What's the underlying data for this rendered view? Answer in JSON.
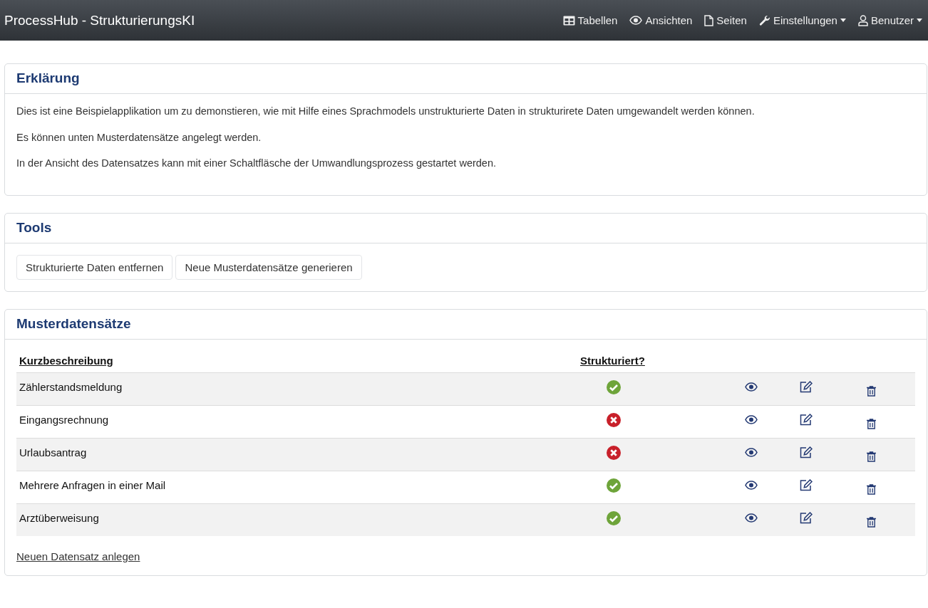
{
  "navbar": {
    "brand": "ProcessHub - StrukturierungsKI",
    "items": [
      {
        "kind": "table",
        "label": "Tabellen",
        "dropdown": false
      },
      {
        "kind": "eye",
        "label": "Ansichten",
        "dropdown": false
      },
      {
        "kind": "page",
        "label": "Seiten",
        "dropdown": false
      },
      {
        "kind": "wrench",
        "label": "Einstellungen",
        "dropdown": true
      },
      {
        "kind": "user",
        "label": "Benutzer",
        "dropdown": true
      }
    ]
  },
  "explanation": {
    "title": "Erklärung",
    "paragraphs": [
      "Dies ist eine Beispielapplikation um zu demonstieren, wie mit Hilfe eines Sprachmodels unstrukturierte Daten in strukturirete Daten umgewandelt werden können.",
      "Es können unten Musterdatensätze angelegt werden.",
      "In der Ansicht des Datensatzes kann mit einer Schaltfläsche der Umwandlungsprozess gestartet werden."
    ]
  },
  "tools": {
    "title": "Tools",
    "buttons": [
      "Strukturierte Daten entfernen",
      "Neue Musterdatensätze generieren"
    ]
  },
  "samples": {
    "title": "Musterdatensätze",
    "columns": [
      "Kurzbeschreibung",
      "Strukturiert?"
    ],
    "rows": [
      {
        "name": "Zählerstandsmeldung",
        "structured": true
      },
      {
        "name": "Eingangsrechnung",
        "structured": false
      },
      {
        "name": "Urlaubsantrag",
        "structured": false
      },
      {
        "name": "Mehrere Anfragen in einer Mail",
        "structured": true
      },
      {
        "name": "Arztüberweisung",
        "structured": true
      }
    ],
    "link": "Neuen Datensatz anlegen"
  }
}
